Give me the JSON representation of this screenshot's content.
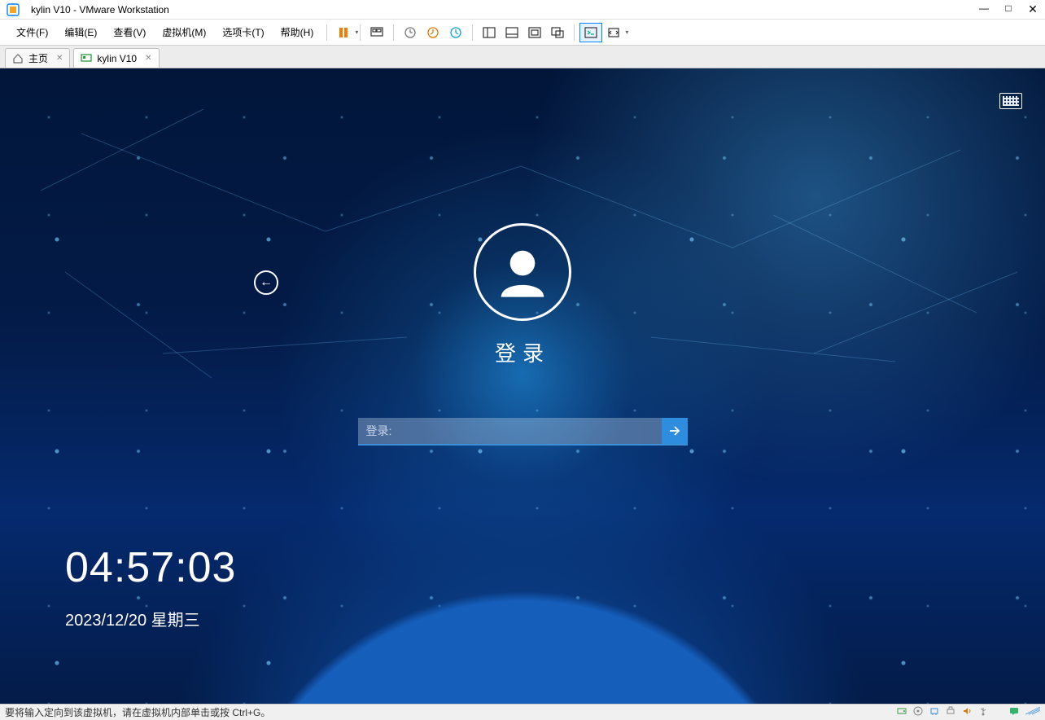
{
  "window": {
    "title": "kylin V10 - VMware Workstation",
    "min": "—",
    "max": "□",
    "close": "✕"
  },
  "menu": {
    "file": "文件(F)",
    "edit": "编辑(E)",
    "view": "查看(V)",
    "vm": "虚拟机(M)",
    "tabs": "选项卡(T)",
    "help": "帮助(H)"
  },
  "tabs": {
    "home": "主页",
    "vm": "kylin V10"
  },
  "login": {
    "title": "登录",
    "placeholder": "登录:",
    "time": "04:57:03",
    "date": "2023/12/20 星期三"
  },
  "status": {
    "msg": "要将输入定向到该虚拟机，请在虚拟机内部单击或按 Ctrl+G。"
  }
}
